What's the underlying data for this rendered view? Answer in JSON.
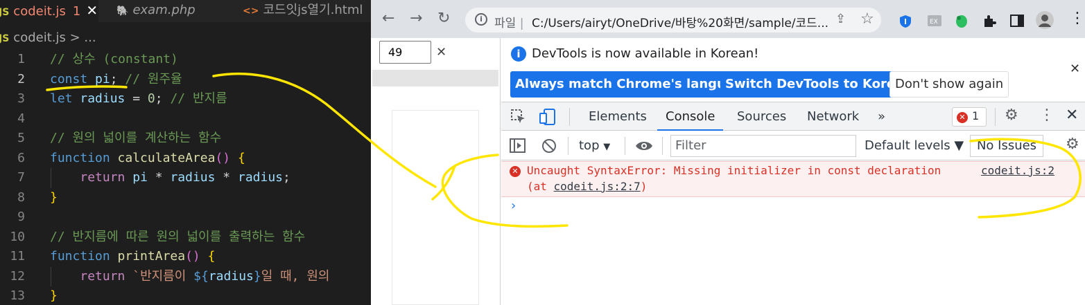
{
  "editor": {
    "tabs": [
      {
        "icon": "JS",
        "label": "codeit.js",
        "badge": "1",
        "close": "✕"
      },
      {
        "icon": "🐘",
        "label": "exam.php"
      },
      {
        "icon": "<>",
        "label": "코드잇js열기.html"
      }
    ],
    "breadcrumb": {
      "icon": "JS",
      "file": "codeit.js",
      "sep": " > ..."
    },
    "lines": [
      {
        "n": "1",
        "parts": [
          {
            "t": "// 상수 (constant)",
            "c": "c-com"
          }
        ]
      },
      {
        "n": "2",
        "parts": [
          {
            "t": "const",
            "c": "c-kw"
          },
          {
            "t": " ",
            "c": "c-txt"
          },
          {
            "t": "pi",
            "c": "c-var"
          },
          {
            "t": "; ",
            "c": "c-txt"
          },
          {
            "t": "// 원주율",
            "c": "c-com"
          }
        ]
      },
      {
        "n": "3",
        "parts": [
          {
            "t": "let",
            "c": "c-kw"
          },
          {
            "t": " ",
            "c": "c-txt"
          },
          {
            "t": "radius",
            "c": "c-var"
          },
          {
            "t": " = ",
            "c": "c-txt"
          },
          {
            "t": "0",
            "c": "c-num"
          },
          {
            "t": "; ",
            "c": "c-txt"
          },
          {
            "t": "// 반지름",
            "c": "c-com"
          }
        ]
      },
      {
        "n": "4",
        "parts": []
      },
      {
        "n": "5",
        "parts": [
          {
            "t": "// 원의 넓이를 계산하는 함수",
            "c": "c-com"
          }
        ]
      },
      {
        "n": "6",
        "parts": [
          {
            "t": "function",
            "c": "c-kw"
          },
          {
            "t": " ",
            "c": "c-txt"
          },
          {
            "t": "calculateArea",
            "c": "c-fn"
          },
          {
            "t": "()",
            "c": "c-br2"
          },
          {
            "t": " ",
            "c": "c-txt"
          },
          {
            "t": "{",
            "c": "c-br"
          }
        ]
      },
      {
        "n": "7",
        "parts": [
          {
            "t": "    ",
            "c": "c-txt"
          },
          {
            "t": "return",
            "c": "c-ctl"
          },
          {
            "t": " ",
            "c": "c-txt"
          },
          {
            "t": "pi",
            "c": "c-var"
          },
          {
            "t": " * ",
            "c": "c-txt"
          },
          {
            "t": "radius",
            "c": "c-var"
          },
          {
            "t": " * ",
            "c": "c-txt"
          },
          {
            "t": "radius",
            "c": "c-var"
          },
          {
            "t": ";",
            "c": "c-txt"
          }
        ]
      },
      {
        "n": "8",
        "parts": [
          {
            "t": "}",
            "c": "c-br"
          }
        ]
      },
      {
        "n": "9",
        "parts": []
      },
      {
        "n": "10",
        "parts": [
          {
            "t": "// 반지름에 따른 원의 넓이를 출력하는 함수",
            "c": "c-com"
          }
        ]
      },
      {
        "n": "11",
        "parts": [
          {
            "t": "function",
            "c": "c-kw"
          },
          {
            "t": " ",
            "c": "c-txt"
          },
          {
            "t": "printArea",
            "c": "c-fn"
          },
          {
            "t": "()",
            "c": "c-br2"
          },
          {
            "t": " ",
            "c": "c-txt"
          },
          {
            "t": "{",
            "c": "c-br"
          }
        ]
      },
      {
        "n": "12",
        "parts": [
          {
            "t": "    ",
            "c": "c-txt"
          },
          {
            "t": "return",
            "c": "c-ctl"
          },
          {
            "t": " `반지름이 ",
            "c": "c-str"
          },
          {
            "t": "${",
            "c": "c-tpl"
          },
          {
            "t": "radius",
            "c": "c-var"
          },
          {
            "t": "}",
            "c": "c-tpl"
          },
          {
            "t": "일 때, 원의",
            "c": "c-str"
          }
        ]
      },
      {
        "n": "13",
        "parts": [
          {
            "t": "}",
            "c": "c-br"
          }
        ]
      }
    ],
    "current_line": "2"
  },
  "browser": {
    "nav": {
      "back": "←",
      "forward": "→",
      "reload": "↻"
    },
    "address": {
      "scheme": "파일",
      "separator": "|",
      "url": "C:/Users/airyt/OneDrive/바탕%20화면/sample/코드..."
    },
    "page": {
      "zoom_value": "49",
      "zoom_close": "✕"
    },
    "devtools": {
      "info": {
        "text": "DevTools is now available in Korean!",
        "btn_match": "Always match Chrome's language",
        "btn_switch": "Switch DevTools to Korean",
        "btn_dont": "Don't show again",
        "close": "✕"
      },
      "tabs": [
        "Elements",
        "Console",
        "Sources",
        "Network"
      ],
      "more_tabs": "»",
      "error_count": "1",
      "console_toolbar": {
        "context": "top",
        "filter_placeholder": "Filter",
        "levels": "Default levels ▼",
        "issues": "No Issues"
      },
      "message": {
        "text": "Uncaught SyntaxError: Missing initializer in const declaration",
        "source": "codeit.js:2",
        "at_prefix": "(at ",
        "at_link": "codeit.js:2:7",
        "at_suffix": ")"
      },
      "prompt": "›"
    }
  },
  "colors": {
    "annotation": "#ffe600",
    "error": "#d93025",
    "accent": "#1a73e8"
  }
}
